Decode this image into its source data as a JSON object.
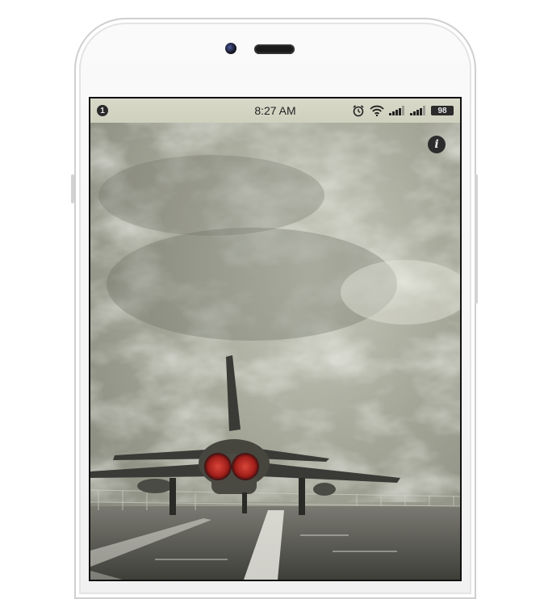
{
  "statusbar": {
    "notification_count": "1",
    "time": "8:27 AM",
    "battery": "98",
    "icons": [
      "alarm-icon",
      "wifi-icon",
      "signal-1-icon",
      "signal-2-icon",
      "battery-icon"
    ]
  },
  "screen": {
    "info_label": "i"
  },
  "colors": {
    "phone_body": "#f4f4f4",
    "status_bar": "#d3d4c3",
    "sky": "#9ea092",
    "icon_dark": "#2c2c2c",
    "jet_exhaust": "#b3241f"
  }
}
